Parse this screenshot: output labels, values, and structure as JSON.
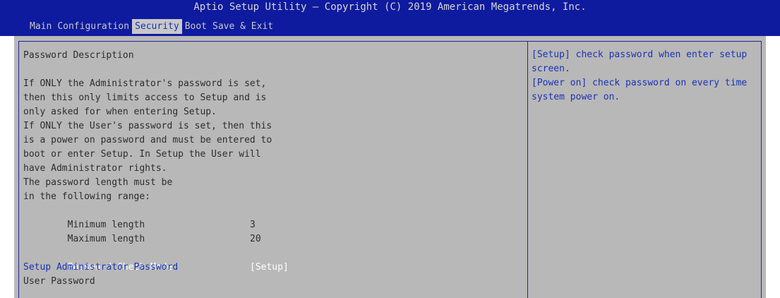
{
  "header": {
    "title": "Aptio Setup Utility – Copyright (C) 2019 American Megatrends, Inc.",
    "tabs": [
      {
        "label": "Main",
        "active": false
      },
      {
        "label": "Configuration",
        "active": false
      },
      {
        "label": "Security",
        "active": true
      },
      {
        "label": "Boot",
        "active": false
      },
      {
        "label": "Save & Exit",
        "active": false
      }
    ]
  },
  "security": {
    "heading": "Password Description",
    "description": [
      "If ONLY the Administrator's password is set,",
      "then this only limits access to Setup and is",
      "only asked for when entering Setup.",
      "If ONLY the User's password is set, then this",
      "is a power on password and must be entered to",
      "boot or enter Setup. In Setup the User will",
      "have Administrator rights.",
      "The password length must be",
      "in the following range:"
    ],
    "min_length_label": "Minimum length",
    "min_length_value": "3",
    "max_length_label": "Maximum length",
    "max_length_value": "20",
    "password_check_mode_label": "Password Check Mode",
    "password_check_mode_value": "[Setup]",
    "setup_admin_password_label": "Setup Administrator Password",
    "user_password_label": "User Password"
  },
  "help": {
    "lines": [
      "[Setup] check password when enter setup",
      "screen.",
      "[Power on] check password on every time",
      "system power on."
    ]
  },
  "colors": {
    "header_bg": "#0f1b9e",
    "panel_bg": "#b8b8b8",
    "highlight_text": "#1a33b4",
    "selected_text": "#ffffff"
  }
}
